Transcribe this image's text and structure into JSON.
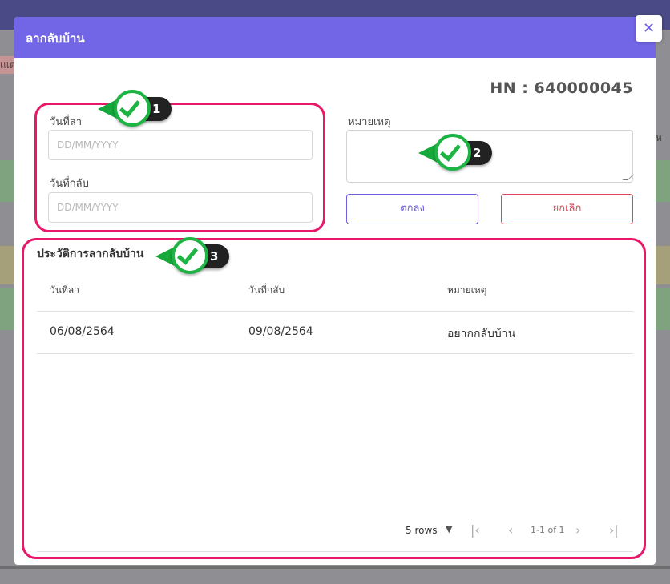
{
  "background": {
    "cut_text_left": "เแต",
    "cut_text_right": "ห"
  },
  "modal": {
    "title": "ลากลับบ้าน",
    "close_glyph": "✕",
    "hn_label": "HN : 640000045"
  },
  "form": {
    "leave_date_label": "วันที่ลา",
    "leave_date_placeholder": "DD/MM/YYYY",
    "return_date_label": "วันที่กลับ",
    "return_date_placeholder": "DD/MM/YYYY",
    "note_label": "หมายเหตุ",
    "ok_label": "ตกลง",
    "cancel_label": "ยกเลิก"
  },
  "history": {
    "title": "ประวัติการลากลับบ้าน",
    "columns": [
      "วันที่ลา",
      "วันที่กลับ",
      "หมายเหตุ"
    ],
    "rows": [
      [
        "06/08/2564",
        "09/08/2564",
        "อยากกลับบ้าน"
      ]
    ],
    "pagination": {
      "rows_per_page": "5 rows",
      "range": "1-1 of 1"
    }
  },
  "annotations": [
    {
      "number": "1"
    },
    {
      "number": "2"
    },
    {
      "number": "3"
    }
  ],
  "colors": {
    "header": "#7366e6",
    "accent": "#6b5ee0",
    "danger": "#e04856",
    "highlight": "#e8176a",
    "badge_green": "#1db443"
  }
}
